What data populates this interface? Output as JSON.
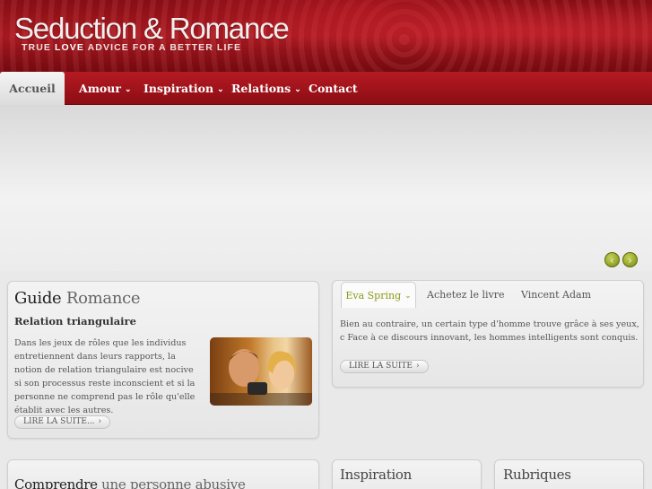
{
  "header": {
    "logo": "Seduction & Romance",
    "tagline_pre": "TRUE ",
    "tagline_accent": "LOVE",
    "tagline_post": " ADVICE FOR A BETTER LIFE"
  },
  "nav": [
    {
      "label": "Accueil",
      "active": true
    },
    {
      "label": "Amour",
      "has_caret": true
    },
    {
      "label": "Inspiration",
      "has_caret": true
    },
    {
      "label": "Relations",
      "has_caret": true
    },
    {
      "label": "Contact"
    }
  ],
  "guide": {
    "title_a": "Guide",
    "title_b": "Romance",
    "subtitle": "Relation triangulaire",
    "text": "Dans les jeux de rôles que les individus entretiennent dans leurs rapports, la notion de relation triangulaire est nocive si son processus reste inconscient et si la personne ne comprend pas le rôle qu'elle établit avec les autres.",
    "read_more": "LIRE LA SUITE..."
  },
  "tabs": {
    "items": [
      "Eva Spring",
      "Achetez le livre",
      "Vincent Adam"
    ],
    "active_index": 0,
    "content": "Bien au contraire, un certain type d'homme trouve grâce à ses yeux, c Face à ce discours innovant, les hommes intelligents sont conquis.",
    "read_more": "LIRE LA SUITE"
  },
  "bottom": {
    "left_title_a": "Comprendre",
    "left_title_b": "une personne abusive",
    "mid_title": "Inspiration",
    "right_title": "Rubriques"
  },
  "colors": {
    "brand_red": "#a3141c",
    "accent_green": "#8a9a14"
  }
}
